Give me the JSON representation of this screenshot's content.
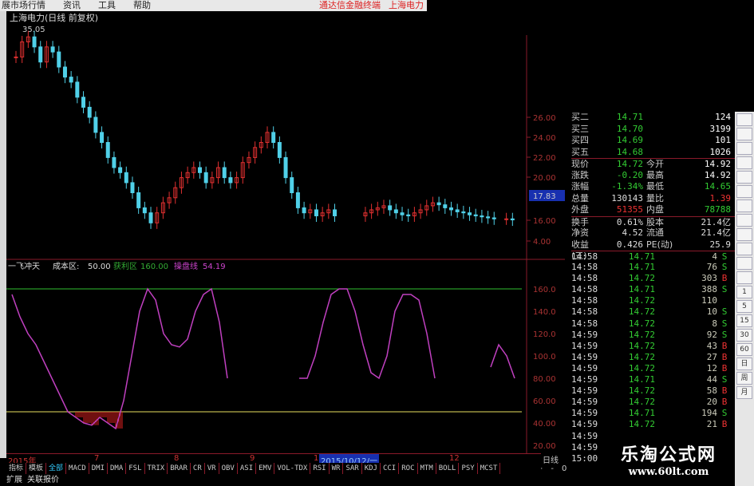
{
  "menu": {
    "items": [
      "展市场行情",
      "资讯",
      "工具",
      "帮助"
    ],
    "right": [
      "通达信金融终端",
      "上海电力"
    ]
  },
  "chart": {
    "title": "上海电力(日线 前复权)",
    "high_label": "35.05",
    "price_axis": [
      "26.00",
      "24.00",
      "22.00",
      "20.00",
      "16.00",
      "4.00"
    ],
    "current_price_tag": "17.83",
    "closes": [
      32,
      33.5,
      34,
      33,
      31.5,
      33,
      32.5,
      31,
      30,
      29.5,
      28,
      27,
      26,
      24.5,
      23.5,
      22,
      21,
      20.5,
      19.5,
      18.5,
      17,
      16.5,
      15.5,
      16.5,
      17.5,
      18,
      19,
      20,
      20.5,
      21,
      20.5,
      19.5,
      20,
      21,
      20,
      19.5,
      20,
      21.5,
      22,
      23,
      23.5,
      24.5,
      23.5,
      22,
      20,
      18.5,
      17,
      16.5,
      16.8,
      16.2,
      16.5,
      16.8,
      16.2,
      null,
      null,
      null,
      null,
      16.5,
      16.8,
      17,
      17.2,
      16.8,
      16.5,
      16.3,
      16.2,
      16.5,
      16.8,
      17.2,
      17.5,
      17.3,
      17,
      16.8,
      16.6,
      16.5,
      16.3,
      16.2,
      16.1,
      16,
      15.9,
      null,
      15.9,
      15.8
    ],
    "colors": {
      "up": "#e03030",
      "down": "#50d0e8",
      "ind": "#c040c0",
      "level_hi": "#30c030",
      "level_lo": "#e8e060"
    }
  },
  "indicator": {
    "name": "一飞冲天",
    "cost_label": "成本区:",
    "cost_value": "50.00",
    "profit_label": "获利区",
    "profit_value": "160.00",
    "ctrl_label": "操盘线",
    "ctrl_value": "54.19",
    "axis": [
      "160.0",
      "140.0",
      "120.0",
      "100.0",
      "80.00",
      "60.00",
      "40.00",
      "20.00"
    ],
    "series": [
      155,
      135,
      120,
      110,
      95,
      80,
      65,
      50,
      45,
      40,
      38,
      45,
      40,
      35,
      60,
      100,
      140,
      160,
      150,
      120,
      110,
      108,
      115,
      140,
      155,
      160,
      130,
      80,
      null,
      null,
      null,
      null,
      null,
      null,
      null,
      null,
      80,
      80,
      100,
      130,
      155,
      160,
      160,
      140,
      110,
      85,
      80,
      100,
      140,
      155,
      155,
      150,
      120,
      80,
      null,
      null,
      null,
      null,
      null,
      null,
      90,
      110,
      100,
      80
    ]
  },
  "order_book": [
    {
      "label": "买二",
      "price": "14.71",
      "vol": "124"
    },
    {
      "label": "买三",
      "price": "14.70",
      "vol": "3199"
    },
    {
      "label": "买四",
      "price": "14.69",
      "vol": "101"
    },
    {
      "label": "买五",
      "price": "14.68",
      "vol": "1026"
    }
  ],
  "quote": [
    {
      "l": "现价",
      "v": "14.72",
      "l2": "今开",
      "v2": "14.92",
      "c": "#3c3",
      "c2": "#fff"
    },
    {
      "l": "涨跌",
      "v": "-0.20",
      "l2": "最高",
      "v2": "14.92",
      "c": "#3c3",
      "c2": "#fff"
    },
    {
      "l": "涨幅",
      "v": "-1.34%",
      "l2": "最低",
      "v2": "14.65",
      "c": "#3c3",
      "c2": "#3c3"
    },
    {
      "l": "总量",
      "v": "130143",
      "l2": "量比",
      "v2": "1.39",
      "c": "#ddd",
      "c2": "#e33"
    },
    {
      "l": "外盘",
      "v": "51355",
      "l2": "内盘",
      "v2": "78788",
      "c": "#e33",
      "c2": "#3c3"
    },
    {
      "l": "换手",
      "v": "0.61%",
      "l2": "股本",
      "v2": "21.4亿",
      "c": "#ddd",
      "c2": "#ddd"
    },
    {
      "l": "净资",
      "v": "4.52",
      "l2": "流通",
      "v2": "21.4亿",
      "c": "#ddd",
      "c2": "#ddd"
    },
    {
      "l": "收益(三)",
      "v": "0.426",
      "l2": "PE(动)",
      "v2": "25.9",
      "c": "#ddd",
      "c2": "#ddd"
    }
  ],
  "trades": [
    [
      "14:58",
      "14.71",
      "4",
      "S"
    ],
    [
      "14:58",
      "14.71",
      "76",
      "S"
    ],
    [
      "14:58",
      "14.72",
      "303",
      "B"
    ],
    [
      "14:58",
      "14.71",
      "388",
      "S"
    ],
    [
      "14:58",
      "14.72",
      "110",
      ""
    ],
    [
      "14:58",
      "14.72",
      "10",
      "S"
    ],
    [
      "14:58",
      "14.72",
      "8",
      "S"
    ],
    [
      "14:59",
      "14.72",
      "92",
      "S"
    ],
    [
      "14:59",
      "14.72",
      "43",
      "B"
    ],
    [
      "14:59",
      "14.72",
      "27",
      "B"
    ],
    [
      "14:59",
      "14.72",
      "12",
      "B"
    ],
    [
      "14:59",
      "14.71",
      "44",
      "S"
    ],
    [
      "14:59",
      "14.72",
      "58",
      "B"
    ],
    [
      "14:59",
      "14.72",
      "20",
      "B"
    ],
    [
      "14:59",
      "14.71",
      "194",
      "S"
    ],
    [
      "14:59",
      "14.72",
      "21",
      "B"
    ],
    [
      "14:59",
      "",
      "",
      ""
    ],
    [
      "14:59",
      "",
      "",
      ""
    ],
    [
      "15:00",
      "",
      "",
      ""
    ]
  ],
  "toolbar": [
    "1",
    "5",
    "15",
    "30",
    "60",
    "日",
    "周",
    "月"
  ],
  "dates": {
    "year": "2015年",
    "months": [
      "7",
      "8",
      "9",
      "1",
      "12"
    ],
    "cursor": "2015/10/12/一",
    "day_label": "日线"
  },
  "zoom": [
    "+",
    "-",
    "0"
  ],
  "tabs": [
    "指标",
    "模板",
    "全部",
    "MACD",
    "DMI",
    "DMA",
    "FSL",
    "TRIX",
    "BRAR",
    "CR",
    "VR",
    "OBV",
    "ASI",
    "EMV",
    "VOL-TDX",
    "RSI",
    "WR",
    "SAR",
    "KDJ",
    "CCI",
    "ROC",
    "MTM",
    "BOLL",
    "PSY",
    "MCST"
  ],
  "bottom": [
    "扩展",
    "关联报价"
  ],
  "watermark": {
    "name": "乐淘公式网",
    "url": "www.60lt.com"
  }
}
